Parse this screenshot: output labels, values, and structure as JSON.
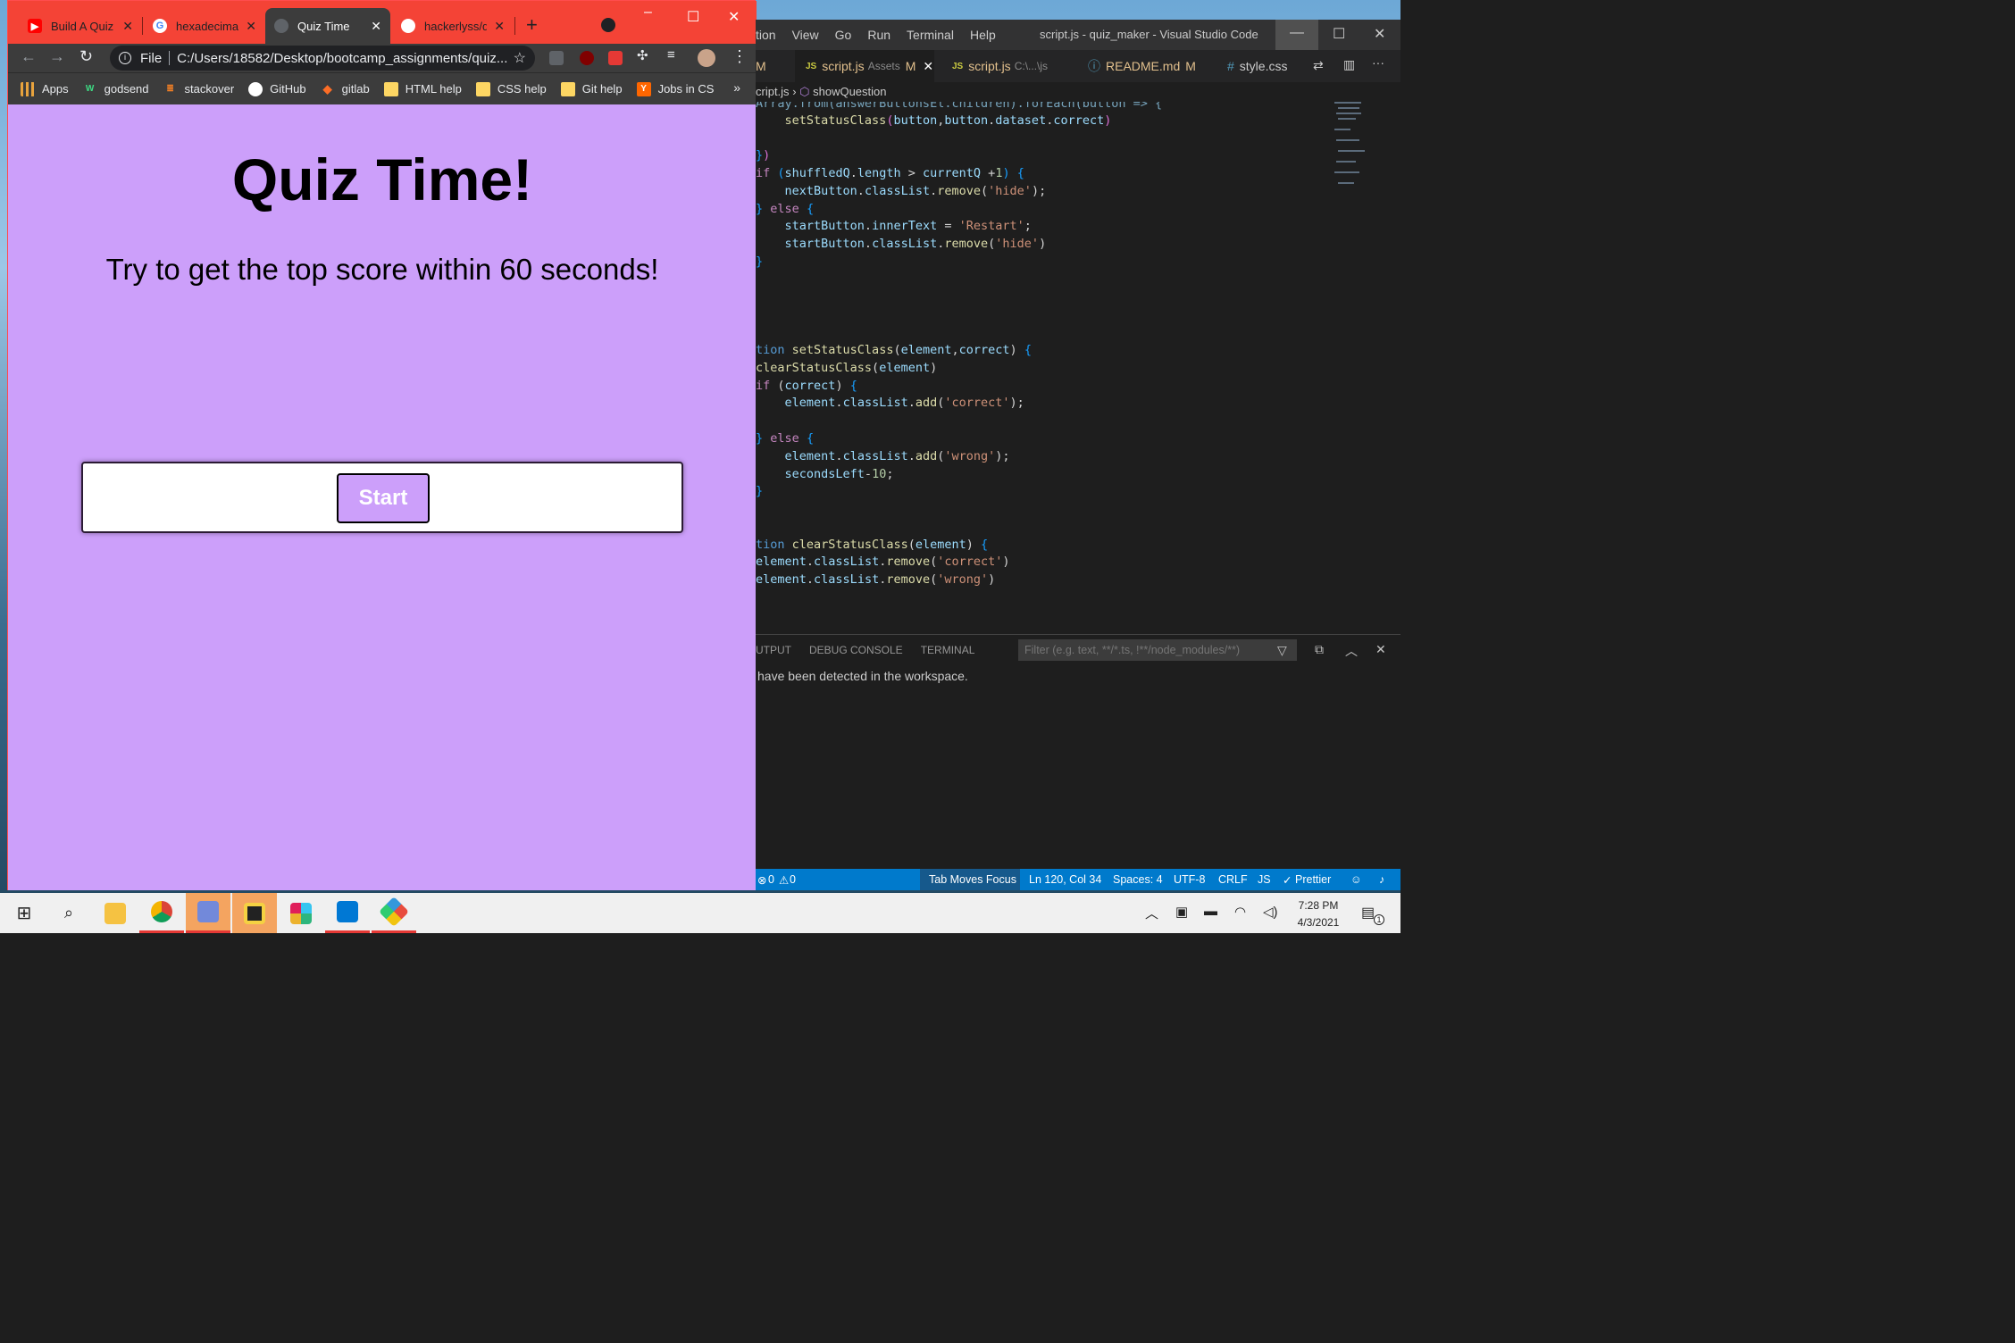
{
  "browser": {
    "tabs": [
      {
        "label": "Build A Quiz",
        "icon": "youtube-icon",
        "color": "#ff0000"
      },
      {
        "label": "hexadecimal",
        "icon": "google-icon",
        "color": "#4285f4"
      },
      {
        "label": "Quiz Time",
        "icon": "globe-icon",
        "color": "#9aa0a6"
      },
      {
        "label": "hackerlyss/qu",
        "icon": "github-icon",
        "color": "#ffffff"
      }
    ],
    "close_glyph": "✕",
    "new_tab_glyph": "+",
    "address": {
      "scheme_label": "File",
      "url": "C:/Users/18582/Desktop/bootcamp_assignments/quiz..."
    },
    "bookmarks": [
      {
        "label": "Apps",
        "icon": "apps-grid-icon",
        "color": "#e8a33d"
      },
      {
        "label": "godsend",
        "icon": "w-logo-icon",
        "color": "#3ddc84"
      },
      {
        "label": "stackover",
        "icon": "stackoverflow-icon",
        "color": "#f48024"
      },
      {
        "label": "GitHub",
        "icon": "github-icon",
        "color": "#ffffff"
      },
      {
        "label": "gitlab",
        "icon": "gitlab-icon",
        "color": "#fc6d26"
      },
      {
        "label": "HTML help",
        "icon": "folder-icon",
        "color": "#fdd663"
      },
      {
        "label": "CSS help",
        "icon": "folder-icon",
        "color": "#fdd663"
      },
      {
        "label": "Git help",
        "icon": "folder-icon",
        "color": "#fdd663"
      },
      {
        "label": "Jobs in CS",
        "icon": "ycombinator-icon",
        "color": "#ff6600"
      }
    ],
    "more_glyph": "»"
  },
  "quiz_page": {
    "title": "Quiz Time!",
    "subtitle": "Try to get the top score within 60 seconds!",
    "start_label": "Start",
    "background": "#cc9ffa"
  },
  "vscode": {
    "menu": [
      "tion",
      "View",
      "Go",
      "Run",
      "Terminal",
      "Help"
    ],
    "title": "script.js - quiz_maker - Visual Studio Code",
    "tabs": [
      {
        "name": "M",
        "sub": "",
        "badge": ""
      },
      {
        "name": "script.js",
        "sub": "Assets",
        "badge": "M"
      },
      {
        "name": "script.js",
        "sub": "C:\\...\\js",
        "badge": ""
      },
      {
        "name": "README.md",
        "sub": "",
        "badge": "M"
      },
      {
        "name": "style.css",
        "sub": "",
        "badge": ""
      }
    ],
    "breadcrumb": {
      "file": "cript.js",
      "symbol": "showQuestion"
    },
    "panel": {
      "tabs": [
        "UTPUT",
        "DEBUG CONSOLE",
        "TERMINAL"
      ],
      "filter_placeholder": "Filter (e.g. text, **/*.ts, !**/node_modules/**)",
      "message": "have been detected in the workspace."
    },
    "status": {
      "problems": "0",
      "warnings": "0",
      "tab_moves_focus": "Tab Moves Focus",
      "position": "Ln 120, Col 34",
      "spaces": "Spaces: 4",
      "encoding": "UTF-8",
      "eol": "CRLF",
      "language": "JS",
      "formatter": "Prettier"
    }
  },
  "taskbar": {
    "time": "7:28 PM",
    "date": "4/3/2021",
    "notifications": "1"
  }
}
